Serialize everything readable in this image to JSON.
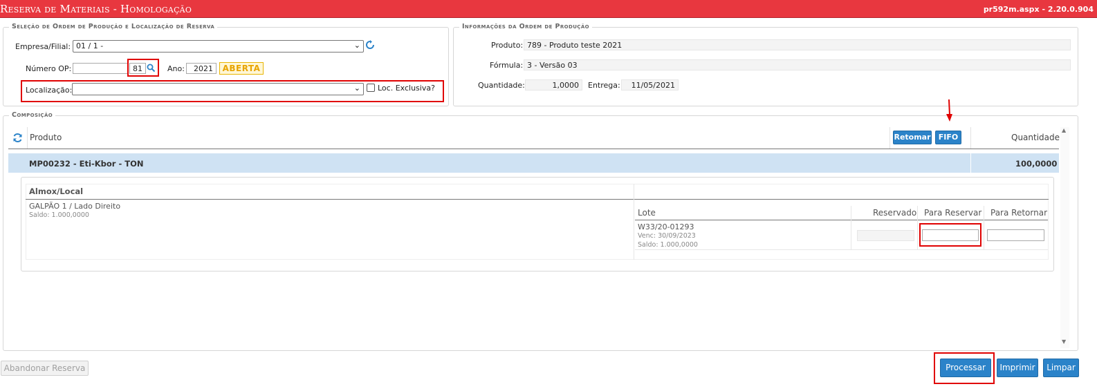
{
  "window": {
    "title": "Reserva de Materiais  - Homologação",
    "version": "pr592m.aspx - 2.20.0.904"
  },
  "selection": {
    "legend": "Seleção de Ordem de Produção e Localização de Reserva",
    "empresa_label": "Empresa/Filial:",
    "empresa_value": "01 / 1 -",
    "numero_op_label": "Número OP:",
    "numero_op_value": "81",
    "ano_label": "Ano:",
    "ano_value": "2021",
    "status_badge": "ABERTA",
    "localizacao_label": "Localização:",
    "localizacao_value": "",
    "loc_exclusiva_label": "Loc. Exclusiva?"
  },
  "info": {
    "legend": "Informações da Ordem de Produção",
    "produto_label": "Produto:",
    "produto_value": "789 - Produto teste 2021",
    "formula_label": "Fórmula:",
    "formula_value": "3 - Versão 03",
    "quantidade_label": "Quantidade:",
    "quantidade_value": "1,0000",
    "entrega_label": "Entrega:",
    "entrega_value": "11/05/2021"
  },
  "composicao": {
    "legend": "Composição",
    "col_produto": "Produto",
    "btn_retomar": "Retomar",
    "btn_fifo": "FIFO",
    "col_quantidade": "Quantidade",
    "item_name": "MP00232 - Eti-Kbor - TON",
    "item_quantity": "100,0000",
    "almox_header": "Almox/Local",
    "almox_name": "GALPÃO 1 / Lado Direito",
    "almox_saldo": "Saldo: 1.000,0000",
    "lote_header": "Lote",
    "reservado_header": "Reservado",
    "para_reservar_header": "Para Reservar",
    "para_retornar_header": "Para Retornar",
    "lote_code": "W33/20-01293",
    "lote_venc": "Venc: 30/09/2023",
    "lote_saldo": "Saldo: 1.000,0000"
  },
  "footer": {
    "abandonar": "Abandonar Reserva",
    "processar": "Processar",
    "imprimir": "Imprimir",
    "limpar": "Limpar"
  },
  "colors": {
    "title_bar": "#e8373f",
    "accent_blue": "#2b83c9",
    "highlight_row": "#cfe2f3",
    "status_yellow": "#e8a400",
    "annotation_red": "#e00000"
  }
}
